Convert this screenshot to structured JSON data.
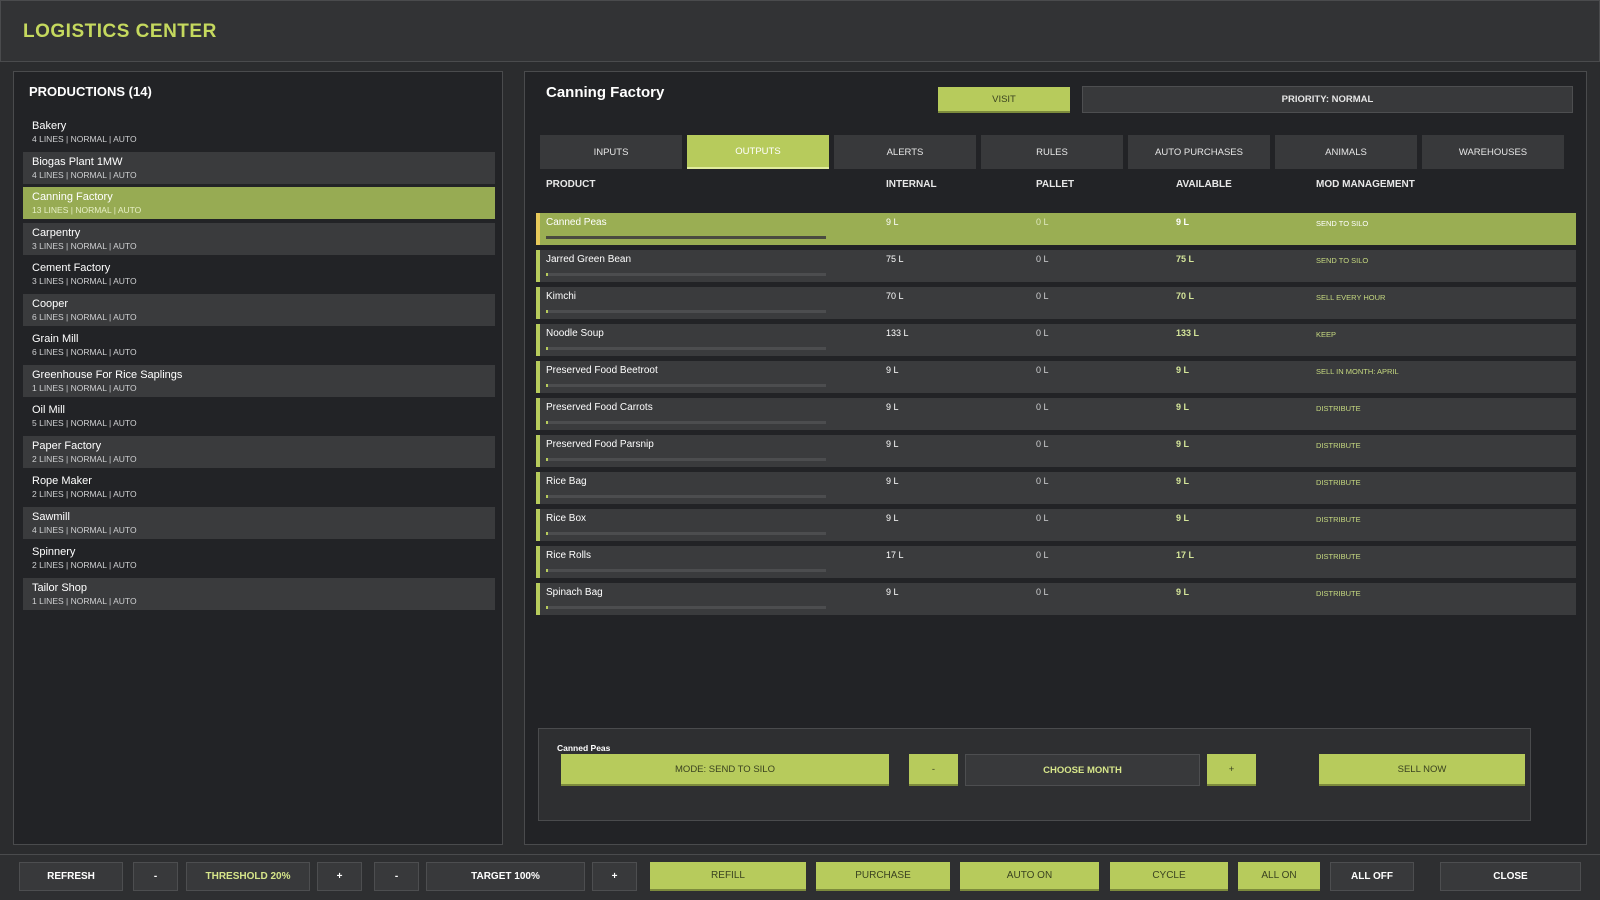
{
  "app": {
    "title": "LOGISTICS CENTER"
  },
  "productions": {
    "title": "PRODUCTIONS (14)",
    "items": [
      {
        "name": "Bakery",
        "meta": "4 LINES | NORMAL | AUTO"
      },
      {
        "name": "Biogas Plant 1MW",
        "meta": "4 LINES | NORMAL | AUTO"
      },
      {
        "name": "Canning Factory",
        "meta": "13 LINES | NORMAL | AUTO"
      },
      {
        "name": "Carpentry",
        "meta": "3 LINES | NORMAL | AUTO"
      },
      {
        "name": "Cement Factory",
        "meta": "3 LINES | NORMAL | AUTO"
      },
      {
        "name": "Cooper",
        "meta": "6 LINES | NORMAL | AUTO"
      },
      {
        "name": "Grain Mill",
        "meta": "6 LINES | NORMAL | AUTO"
      },
      {
        "name": "Greenhouse For Rice Saplings",
        "meta": "1 LINES | NORMAL | AUTO"
      },
      {
        "name": "Oil Mill",
        "meta": "5 LINES | NORMAL | AUTO"
      },
      {
        "name": "Paper Factory",
        "meta": "2 LINES | NORMAL | AUTO"
      },
      {
        "name": "Rope Maker",
        "meta": "2 LINES | NORMAL | AUTO"
      },
      {
        "name": "Sawmill",
        "meta": "4 LINES | NORMAL | AUTO"
      },
      {
        "name": "Spinnery",
        "meta": "2 LINES | NORMAL | AUTO"
      },
      {
        "name": "Tailor Shop",
        "meta": "1 LINES | NORMAL | AUTO"
      }
    ]
  },
  "detail": {
    "title": "Canning Factory",
    "visit_label": "VISIT",
    "priority_label": "PRIORITY: NORMAL",
    "tabs": [
      "INPUTS",
      "OUTPUTS",
      "ALERTS",
      "RULES",
      "AUTO PURCHASES",
      "ANIMALS",
      "WAREHOUSES"
    ],
    "active_tab": "OUTPUTS",
    "columns": {
      "product": "PRODUCT",
      "internal": "INTERNAL",
      "pallet": "PALLET",
      "available": "AVAILABLE",
      "mod": "MOD MANAGEMENT"
    },
    "rows": [
      {
        "product": "Canned Peas",
        "internal": "9 L",
        "pallet": "0 L",
        "available": "9 L",
        "mod": "SEND TO SILO",
        "fill": 0.0
      },
      {
        "product": "Jarred Green Bean",
        "internal": "75 L",
        "pallet": "0 L",
        "available": "75 L",
        "mod": "SEND TO SILO",
        "fill": 0.005
      },
      {
        "product": "Kimchi",
        "internal": "70 L",
        "pallet": "0 L",
        "available": "70 L",
        "mod": "SELL EVERY HOUR",
        "fill": 0.005
      },
      {
        "product": "Noodle Soup",
        "internal": "133 L",
        "pallet": "0 L",
        "available": "133 L",
        "mod": "KEEP",
        "fill": 0.005
      },
      {
        "product": "Preserved Food Beetroot",
        "internal": "9 L",
        "pallet": "0 L",
        "available": "9 L",
        "mod": "SELL IN MONTH: APRIL",
        "fill": 0.005
      },
      {
        "product": "Preserved Food Carrots",
        "internal": "9 L",
        "pallet": "0 L",
        "available": "9 L",
        "mod": "DISTRIBUTE",
        "fill": 0.005
      },
      {
        "product": "Preserved Food Parsnip",
        "internal": "9 L",
        "pallet": "0 L",
        "available": "9 L",
        "mod": "DISTRIBUTE",
        "fill": 0.005
      },
      {
        "product": "Rice Bag",
        "internal": "9 L",
        "pallet": "0 L",
        "available": "9 L",
        "mod": "DISTRIBUTE",
        "fill": 0.005
      },
      {
        "product": "Rice Box",
        "internal": "9 L",
        "pallet": "0 L",
        "available": "9 L",
        "mod": "DISTRIBUTE",
        "fill": 0.005
      },
      {
        "product": "Rice Rolls",
        "internal": "17 L",
        "pallet": "0 L",
        "available": "17 L",
        "mod": "DISTRIBUTE",
        "fill": 0.005
      },
      {
        "product": "Spinach Bag",
        "internal": "9 L",
        "pallet": "0 L",
        "available": "9 L",
        "mod": "DISTRIBUTE",
        "fill": 0.005
      }
    ],
    "action": {
      "selected_product": "Canned Peas",
      "mode_label": "MODE: SEND TO SILO",
      "minus_label": "-",
      "month_label": "CHOOSE MONTH",
      "plus_label": "+",
      "sell_label": "SELL NOW"
    }
  },
  "footer": {
    "refresh": "REFRESH",
    "threshold_minus": "-",
    "threshold": "THRESHOLD 20%",
    "threshold_plus": "+",
    "target_minus": "-",
    "target": "TARGET 100%",
    "target_plus": "+",
    "refill": "REFILL",
    "purchase": "PURCHASE",
    "auto_on": "AUTO ON",
    "cycle": "CYCLE",
    "all_on": "ALL ON",
    "all_off": "ALL OFF",
    "close": "CLOSE"
  },
  "colors": {
    "accent": "#b7cb5c",
    "title": "#c5d95e",
    "selected_row": "#9aae53",
    "panel": "#222326"
  }
}
